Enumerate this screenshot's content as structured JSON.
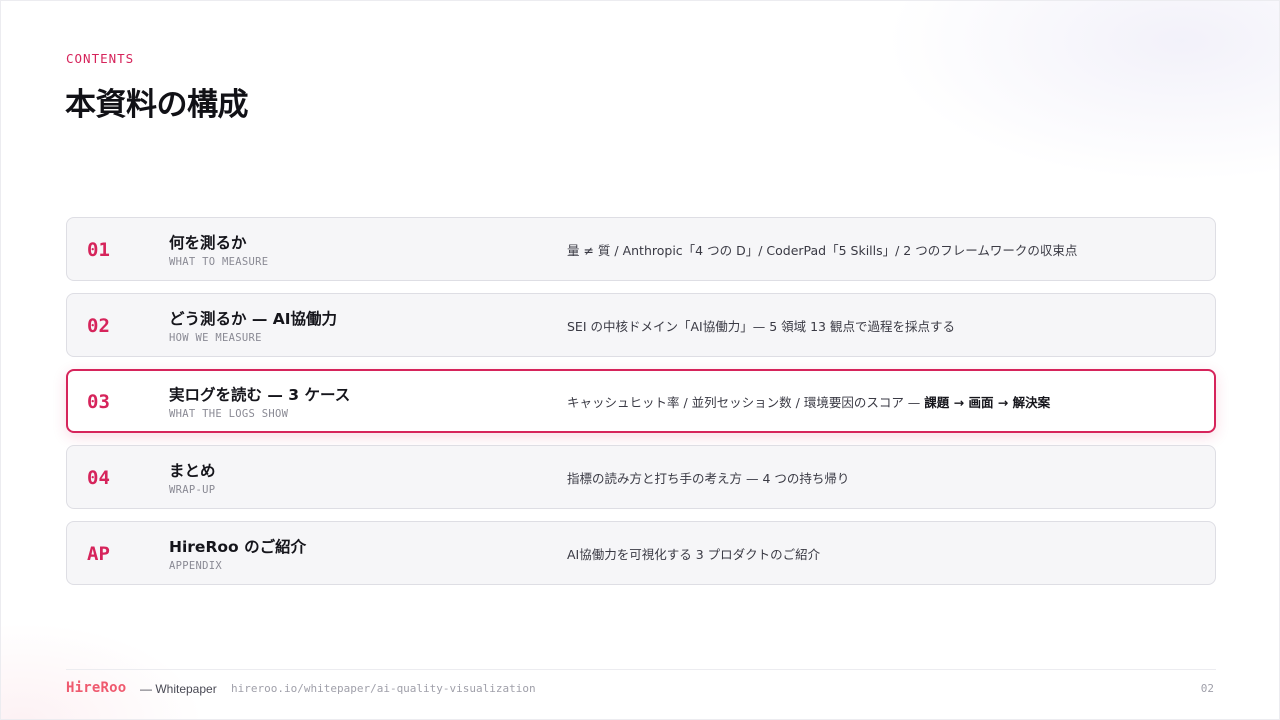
{
  "header": {
    "eyebrow": "CONTENTS",
    "title": "本資料の構成"
  },
  "accent_color": "#d6245b",
  "rows": [
    {
      "num": "01",
      "title": "何を測るか",
      "subtitle": "WHAT TO MEASURE",
      "desc": "量 ≠ 質 / Anthropic「4 つの D」/ CoderPad「5 Skills」/ 2 つのフレームワークの収束点",
      "active": false
    },
    {
      "num": "02",
      "title": "どう測るか — AI協働力",
      "subtitle": "HOW WE MEASURE",
      "desc": "SEI の中核ドメイン「AI協働力」— 5 領域 13 観点で過程を採点する",
      "active": false
    },
    {
      "num": "03",
      "title": "実ログを読む — 3 ケース",
      "subtitle": "WHAT THE LOGS SHOW",
      "desc": "キャッシュヒット率 / 並列セッション数 / 環境要因のスコア — ",
      "desc_bold": "課題 → 画面 → 解決案",
      "active": true
    },
    {
      "num": "04",
      "title": "まとめ",
      "subtitle": "WRAP-UP",
      "desc": "指標の読み方と打ち手の考え方 — 4 つの持ち帰り",
      "active": false
    },
    {
      "num": "AP",
      "title": "HireRoo のご紹介",
      "subtitle": "APPENDIX",
      "desc": "AI協働力を可視化する 3 プロダクトのご紹介",
      "active": false
    }
  ],
  "footer": {
    "logo": "HireRoo",
    "tag": "— Whitepaper",
    "url": "hireroo.io/whitepaper/ai-quality-visualization",
    "page": "02"
  }
}
